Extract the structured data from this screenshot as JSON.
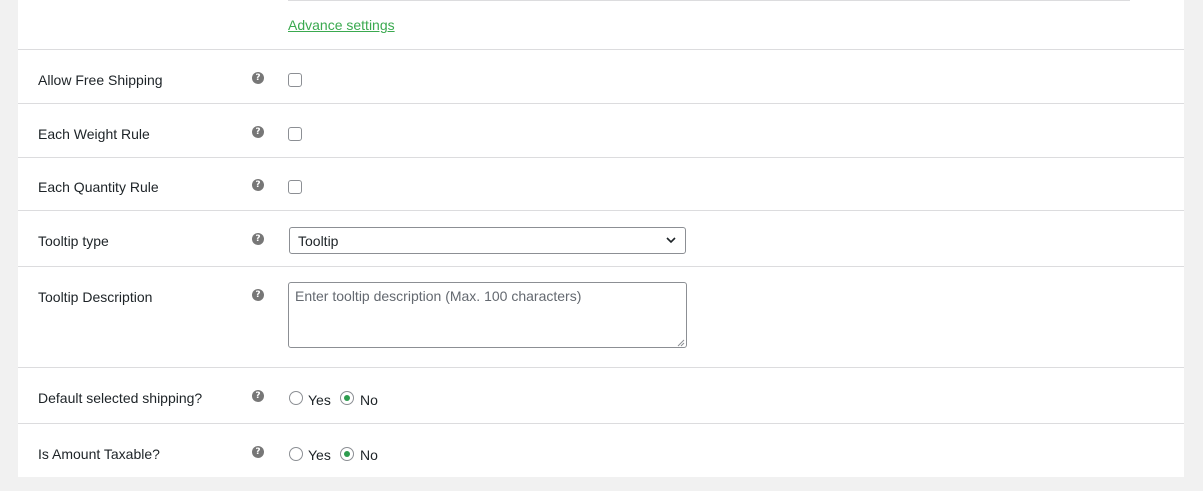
{
  "advance_settings_link": "Advance settings",
  "help_icon_glyph": "?",
  "rows": {
    "allow_free_shipping": {
      "label": "Allow Free Shipping",
      "checked": false
    },
    "each_weight_rule": {
      "label": "Each Weight Rule",
      "checked": false
    },
    "each_quantity_rule": {
      "label": "Each Quantity Rule",
      "checked": false
    },
    "tooltip_type": {
      "label": "Tooltip type",
      "selected": "Tooltip"
    },
    "tooltip_description": {
      "label": "Tooltip Description",
      "value": "",
      "placeholder": "Enter tooltip description (Max. 100 characters)"
    },
    "default_selected_shipping": {
      "label": "Default selected shipping?",
      "yes": "Yes",
      "no": "No",
      "selected": "No"
    },
    "is_amount_taxable": {
      "label": "Is Amount Taxable?",
      "yes": "Yes",
      "no": "No",
      "selected": "No"
    }
  },
  "colors": {
    "link": "#3aa94f",
    "radio_selected": "#2e9c4f",
    "border": "#dcdcde",
    "help_icon": "#777777"
  }
}
